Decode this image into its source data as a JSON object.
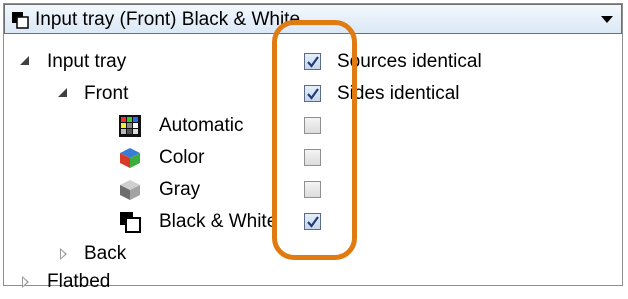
{
  "header": {
    "title": "Input tray (Front) Black & White",
    "icon": "black-white-mode-icon",
    "dropdown_icon": "chevron-down-icon"
  },
  "tree": {
    "input_tray": {
      "label": "Input tray",
      "expanded": true
    },
    "front": {
      "label": "Front",
      "expanded": true
    },
    "modes": [
      {
        "label": "Automatic",
        "icon": "automatic-mode-icon",
        "checked": false
      },
      {
        "label": "Color",
        "icon": "color-mode-icon",
        "checked": false
      },
      {
        "label": "Gray",
        "icon": "gray-mode-icon",
        "checked": false
      },
      {
        "label": "Black & White",
        "icon": "black-white-mode-icon",
        "checked": true
      }
    ],
    "back": {
      "label": "Back",
      "expanded": false
    },
    "flatbed": {
      "label": "Flatbed",
      "expanded": false
    }
  },
  "options": {
    "sources_identical": {
      "label": "Sources identical",
      "checked": true
    },
    "sides_identical": {
      "label": "Sides identical",
      "checked": true
    }
  },
  "colors": {
    "highlight": "#e07b12",
    "header_bg": "#dbe8f6",
    "checkbox_check": "#1f3f7a"
  }
}
